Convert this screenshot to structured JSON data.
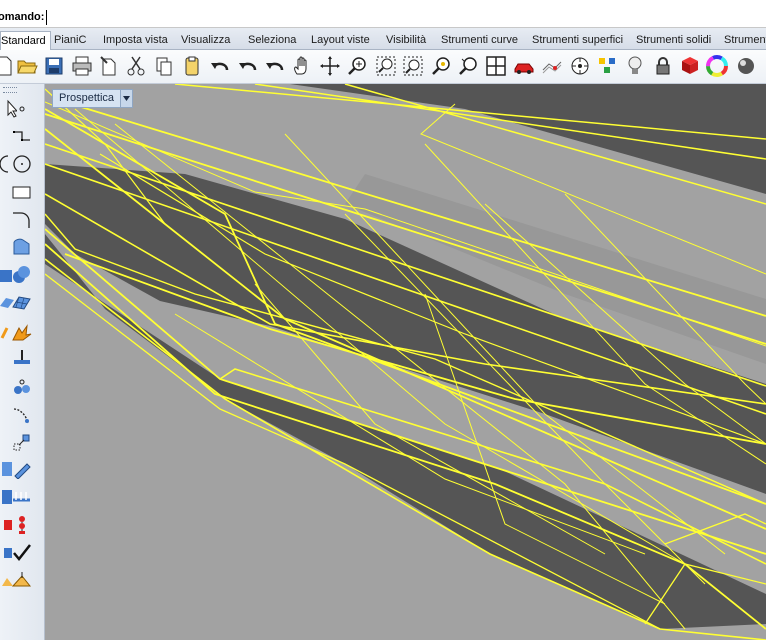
{
  "command": {
    "label": "omando:",
    "value": ""
  },
  "tabs": [
    "Standard",
    "PianiC",
    "Imposta vista",
    "Visualizza",
    "Seleziona",
    "Layout viste",
    "Visibilità",
    "Strumenti curve",
    "Strumenti superfici",
    "Strumenti solidi",
    "Strument"
  ],
  "active_tab": "Standard",
  "toolbar": {
    "icons": [
      "new-file-icon",
      "open-folder-icon",
      "save-icon",
      "print-icon",
      "import-icon",
      "cut-icon",
      "copy-icon",
      "paste-icon",
      "undo-icon",
      "redo-icon",
      "undo-view-icon",
      "pan-hand-icon",
      "rotate-view-icon",
      "zoom-icon",
      "zoom-window-icon",
      "zoom-extents-icon",
      "zoom-selected-icon",
      "four-viewports-icon",
      "car-render-icon",
      "wireframe-icon",
      "target-icon",
      "layers-icon",
      "light-bulb-icon",
      "lock-icon",
      "material-icon",
      "color-wheel-icon",
      "sphere-render-icon"
    ]
  },
  "left_toolbar": {
    "icons": [
      "point-icon",
      "polyline-icon",
      "circle-icon",
      "arc-icon",
      "rectangle-icon",
      "curve-fillet-icon",
      "surface-icon",
      "solid-sphere-icon",
      "mesh-surface-icon",
      "explode-icon",
      "boolean-icon",
      "group-icon",
      "curve-from-object-icon",
      "transform-icon",
      "surface-tools-icon",
      "dimension-icon",
      "gumball-icon",
      "check-icon",
      "analyze-icon"
    ]
  },
  "viewport": {
    "title": "Prospettica",
    "background": "#a2a2a2",
    "surface_color": "#555555",
    "wire_color": "#ffff33"
  }
}
